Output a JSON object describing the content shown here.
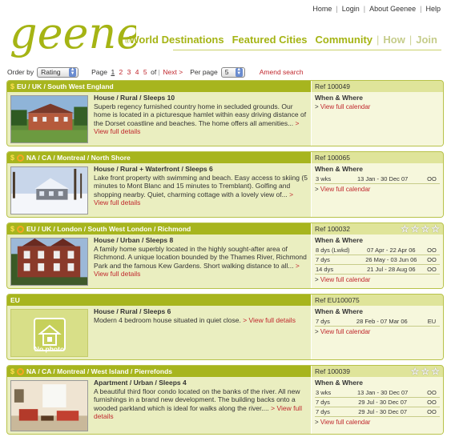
{
  "brand": {
    "name": "geenee",
    "reg": "®",
    "color": "#a5b414"
  },
  "top_links": [
    "Home",
    "Login",
    "About Geenee",
    "Help"
  ],
  "main_nav": [
    {
      "label": "World Destinations",
      "active": true
    },
    {
      "label": "Featured Cities",
      "active": true
    },
    {
      "label": "Community",
      "active": true
    },
    {
      "label": "How",
      "active": false
    },
    {
      "label": "Join",
      "active": false
    }
  ],
  "toolbar": {
    "order_by_label": "Order by",
    "order_by_value": "Rating",
    "page_label": "Page",
    "pages": [
      "1",
      "2",
      "3",
      "4",
      "5"
    ],
    "current_page": "1",
    "of_label": "of",
    "next_label": "Next >",
    "per_page_label": "Per page",
    "per_page_value": "5",
    "amend_label": "Amend search"
  },
  "listings": [
    {
      "dollar": "$",
      "ring": false,
      "region": "EU / UK / South West England",
      "ref": "Ref 100049",
      "stars": 0,
      "title": "House / Rural / Sleeps 10",
      "description": "Superb regency furnished country home in secluded grounds. Our home is located in a picturesque hamlet within easy driving distance of the Dorset coastline and beaches. The home offers all amenities...",
      "details_label": "> View full details",
      "photo": "house",
      "when_label": "When & Where",
      "dates": [],
      "calendar_label": "View full calendar"
    },
    {
      "dollar": "$",
      "ring": true,
      "region": "NA / CA / Montreal / North Shore",
      "ref": "Ref 100065",
      "stars": 0,
      "title": "House / Rural + Waterfront / Sleeps 6",
      "description": "Lake front property with swimming and beach. Easy access to skiing (5 minutes to Mont Blanc and 15 minutes to Tremblant). Golfing and shopping nearby. Quiet, charming cottage with a lovely view of...",
      "details_label": "> View full details",
      "photo": "snow",
      "when_label": "When & Where",
      "dates": [
        {
          "duration": "3 wks",
          "range": "13 Jan - 30 Dec 07",
          "code": "OO"
        }
      ],
      "calendar_label": "View full calendar"
    },
    {
      "dollar": "$",
      "ring": true,
      "region": "EU / UK / London / South West London / Richmond",
      "ref": "Ref 100032",
      "stars": 4,
      "title": "House / Urban / Sleeps 8",
      "description": "A family home superbly located in the highly sought-after area of Richmond. A unique location bounded by the Thames River, Richmond Park and the famous Kew Gardens. Short walking distance to all...",
      "details_label": "> View full details",
      "photo": "brick",
      "when_label": "When & Where",
      "dates": [
        {
          "duration": "8 dys (Lwkd)",
          "range": "07 Apr - 22 Apr 06",
          "code": "OO"
        },
        {
          "duration": "7 dys",
          "range": "26 May - 03 Jun 06",
          "code": "OO"
        },
        {
          "duration": "14 dys",
          "range": "21 Jul - 28 Aug 06",
          "code": "OO"
        }
      ],
      "calendar_label": "View full calendar"
    },
    {
      "dollar": "",
      "ring": false,
      "region": "EU",
      "ref": "Ref EU100075",
      "stars": 0,
      "title": "House / Rural / Sleeps 6",
      "description": "Modern 4 bedroom house situated in quiet close.",
      "details_label": "> View full details",
      "photo": "none",
      "no_photo_label": "No photo",
      "when_label": "When & Where",
      "dates": [
        {
          "duration": "7 dys",
          "range": "28 Feb - 07 Mar 06",
          "code": "EU"
        }
      ],
      "calendar_label": "View full calendar"
    },
    {
      "dollar": "$",
      "ring": true,
      "region": "NA / CA / Montreal / West Island / Pierrefonds",
      "ref": "Ref 100039",
      "stars": 3,
      "title": "Apartment / Urban / Sleeps 4",
      "description": "A beautiful third floor condo located on the banks of the river. All new furnishings in a brand new development. The building backs onto a wooded parkland which is ideal for walks along the river....",
      "details_label": "> View full details",
      "photo": "interior",
      "when_label": "When & Where",
      "dates": [
        {
          "duration": "3 wks",
          "range": "13 Jan - 30 Dec 07",
          "code": "OO"
        },
        {
          "duration": "7 dys",
          "range": "29 Jul - 30 Dec 07",
          "code": "OO"
        },
        {
          "duration": "7 dys",
          "range": "29 Jul - 30 Dec 07",
          "code": "OO"
        }
      ],
      "calendar_label": "View full calendar"
    }
  ]
}
